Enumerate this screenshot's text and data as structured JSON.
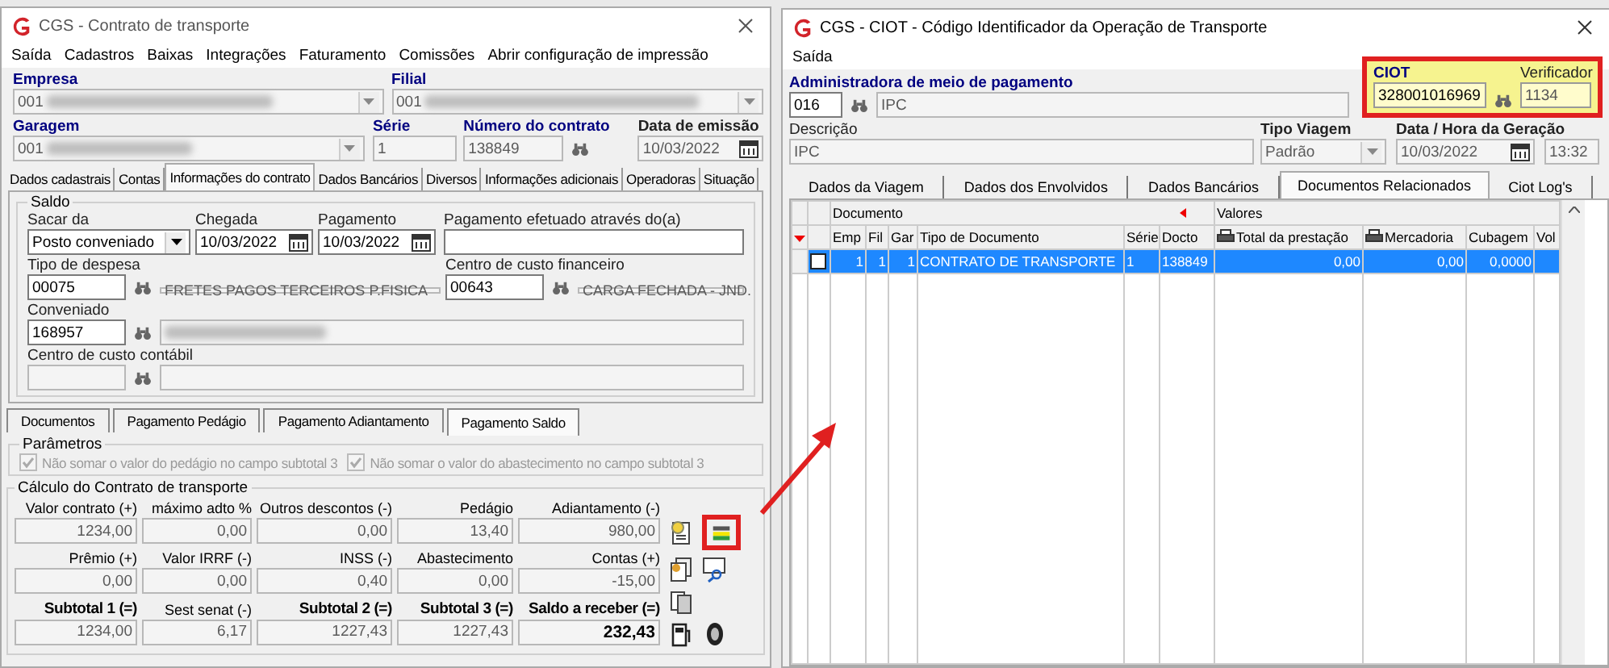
{
  "left_window": {
    "title": "CGS - Contrato de transporte",
    "menu": [
      "Saída",
      "Cadastros",
      "Baixas",
      "Integrações",
      "Faturamento",
      "Comissões",
      "Abrir configuração de impressão"
    ],
    "empresa": {
      "label": "Empresa",
      "value": "001",
      "blurred": true
    },
    "filial": {
      "label": "Filial",
      "value": "001",
      "blurred": true
    },
    "garagem": {
      "label": "Garagem",
      "value": "001",
      "blurred": true
    },
    "serie": {
      "label": "Série",
      "value": "1"
    },
    "numero_contrato": {
      "label": "Número do contrato",
      "value": "138849"
    },
    "data_emissao": {
      "label": "Data de emissão",
      "value": "10/03/2022"
    },
    "tabs": [
      {
        "label": "Dados cadastrais",
        "selected": false
      },
      {
        "label": "Contas",
        "selected": false
      },
      {
        "label": "Informações do contrato",
        "selected": true
      },
      {
        "label": "Dados Bancários",
        "selected": false
      },
      {
        "label": "Diversos",
        "selected": false
      },
      {
        "label": "Informações adicionais",
        "selected": false
      },
      {
        "label": "Operadoras",
        "selected": false
      },
      {
        "label": "Situação",
        "selected": false
      }
    ],
    "saldo": {
      "legend": "Saldo",
      "sacar_da": {
        "label": "Sacar da",
        "value": "Posto conveniado"
      },
      "chegada": {
        "label": "Chegada",
        "value": "10/03/2022"
      },
      "pagamento": {
        "label": "Pagamento",
        "value": "10/03/2022"
      },
      "pagamento_efetuado": {
        "label": "Pagamento efetuado através do(a)"
      },
      "tipo_despesa": {
        "label": "Tipo de despesa",
        "code": "00075",
        "description": "FRETES PAGOS TERCEIROS P.FISICA"
      },
      "centro_custo_financeiro": {
        "label": "Centro de custo financeiro",
        "code": "00643",
        "description": "CARGA FECHADA - JND."
      },
      "conveniado": {
        "label": "Conveniado",
        "code": "168957",
        "blurred": true
      },
      "centro_custo_contabil": {
        "label": "Centro de custo contábil"
      }
    },
    "sub_tabs": [
      {
        "label": "Documentos",
        "selected": false
      },
      {
        "label": "Pagamento Pedágio",
        "selected": false
      },
      {
        "label": "Pagamento Adiantamento",
        "selected": false
      },
      {
        "label": "Pagamento Saldo",
        "selected": true
      }
    ],
    "parametros": {
      "legend": "Parâmetros",
      "options": [
        {
          "label": "Não somar o valor do pedágio no campo subtotal 3",
          "checked": true,
          "disabled": true
        },
        {
          "label": "Não somar o valor do abastecimento no campo subtotal 3",
          "checked": true,
          "disabled": true
        }
      ]
    },
    "calculo": {
      "legend": "Cálculo do Contrato de transporte",
      "fields": [
        {
          "label": "Valor contrato (+)",
          "value": "1234,00",
          "kind": "normal"
        },
        {
          "label": "máximo adto %",
          "value": "0,00",
          "kind": "normal"
        },
        {
          "label": "Outros descontos (-)",
          "value": "0,00",
          "kind": "normal"
        },
        {
          "label": "Pedágio",
          "value": "13,40",
          "kind": "normal"
        },
        {
          "label": "Adiantamento (-)",
          "value": "980,00",
          "kind": "normal"
        },
        {
          "label": "Prêmio (+)",
          "value": "0,00",
          "kind": "normal"
        },
        {
          "label": "Valor IRRF (-)",
          "value": "0,00",
          "kind": "normal"
        },
        {
          "label": "INSS (-)",
          "value": "0,40",
          "kind": "normal"
        },
        {
          "label": "Abastecimento",
          "value": "0,00",
          "kind": "normal"
        },
        {
          "label": "Contas (+)",
          "value": "-15,00",
          "kind": "normal"
        },
        {
          "label": "Subtotal 1 (=)",
          "value": "1234,00",
          "kind": "total"
        },
        {
          "label": "Sest senat (-)",
          "value": "6,17",
          "kind": "normal"
        },
        {
          "label": "Subtotal 2 (=)",
          "value": "1227,43",
          "kind": "total"
        },
        {
          "label": "Subtotal 3 (=)",
          "value": "1227,43",
          "kind": "total"
        },
        {
          "label": "Saldo a receber (=)",
          "value": "232,43",
          "kind": "result"
        }
      ]
    },
    "ciot_button": {
      "highlighted": true
    }
  },
  "right_window": {
    "title": "CGS - CIOT - Código Identificador da Operação de Transporte",
    "menu": [
      "Saída"
    ],
    "administradora": {
      "label": "Administradora de meio de pagamento",
      "code": "016",
      "name": "IPC"
    },
    "ciot_box": {
      "highlighted": true,
      "ciot": {
        "label": "CIOT",
        "value": "328001016969"
      },
      "verificador": {
        "label": "Verificador",
        "value": "1134"
      }
    },
    "descricao": {
      "label": "Descrição",
      "value": "IPC"
    },
    "tipo_viagem": {
      "label": "Tipo Viagem",
      "value": "Padrão"
    },
    "data_hora": {
      "label": "Data / Hora da Geração",
      "date": "10/03/2022",
      "time": "13:32"
    },
    "tabs": [
      {
        "label": "Dados da Viagem",
        "selected": false
      },
      {
        "label": "Dados dos Envolvidos",
        "selected": false
      },
      {
        "label": "Dados Bancários",
        "selected": false
      },
      {
        "label": "Documentos Relacionados",
        "selected": true
      },
      {
        "label": "Ciot Log's",
        "selected": false
      }
    ],
    "grid": {
      "groups": [
        {
          "label": "Documento"
        },
        {
          "label": "Valores"
        }
      ],
      "columns": [
        {
          "label": "Emp",
          "kind": "text"
        },
        {
          "label": "Fil",
          "kind": "text"
        },
        {
          "label": "Gar",
          "kind": "text"
        },
        {
          "label": "Tipo de Documento",
          "kind": "text"
        },
        {
          "label": "Série",
          "kind": "text"
        },
        {
          "label": "Docto",
          "kind": "text"
        },
        {
          "label": "Total da prestação",
          "kind": "printer"
        },
        {
          "label": "Mercadoria",
          "kind": "printer"
        },
        {
          "label": "Cubagem",
          "kind": "text"
        },
        {
          "label": "Vol",
          "kind": "text"
        }
      ],
      "rows": [
        {
          "checked": false,
          "selected": true,
          "cells": [
            "1",
            "1",
            "1",
            "CONTRATO DE TRANSPORTE",
            "1",
            "138849",
            "0,00",
            "0,00",
            "0,0000"
          ]
        }
      ]
    }
  }
}
